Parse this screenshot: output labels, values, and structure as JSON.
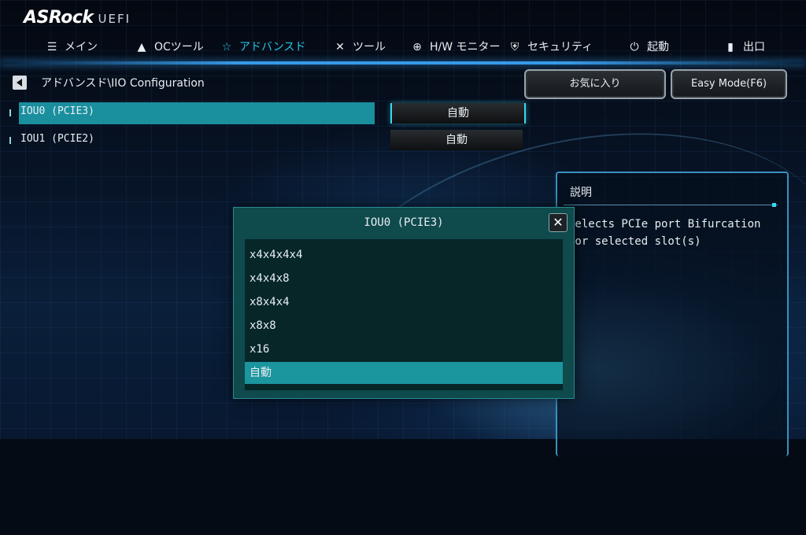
{
  "header": {
    "brand": "ASRock",
    "brand_suffix": "UEFI"
  },
  "nav": {
    "items": [
      {
        "label": "メイン",
        "icon": "menu-grid-icon"
      },
      {
        "label": "OCツール",
        "icon": "rocket-icon"
      },
      {
        "label": "アドバンスド",
        "icon": "star-icon",
        "active": true
      },
      {
        "label": "ツール",
        "icon": "tools-icon"
      },
      {
        "label": "H/W モニター",
        "icon": "target-icon"
      },
      {
        "label": "セキュリティ",
        "icon": "shield-icon"
      },
      {
        "label": "起動",
        "icon": "power-icon"
      },
      {
        "label": "出口",
        "icon": "exit-door-icon"
      }
    ]
  },
  "breadcrumb": "アドバンスド\\IIO Configuration",
  "buttons": {
    "favorites": "お気に入り",
    "easy_mode": "Easy Mode(F6)"
  },
  "settings": [
    {
      "label": "IOU0 (PCIE3)",
      "value": "自動"
    },
    {
      "label": "IOU1 (PCIE2)",
      "value": "自動"
    }
  ],
  "description": {
    "title": "説明",
    "text": "Selects PCIe port Bifurcation\nfor selected slot(s)"
  },
  "popup": {
    "title": "IOU0 (PCIE3)",
    "close": "✕",
    "options": [
      "x4x4x4x4",
      "x4x4x8",
      "x8x4x4",
      "x8x8",
      "x16",
      "自動"
    ],
    "selected_option": "自動"
  },
  "colors": {
    "accent": "#25c6e6",
    "selection": "#1a8f9e",
    "popup_bg": "#0f4a4d"
  }
}
